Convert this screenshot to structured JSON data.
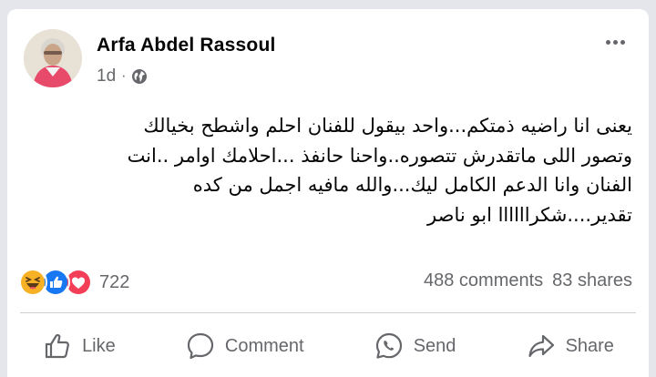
{
  "post": {
    "author": "Arfa Abdel Rassoul",
    "time": "1d",
    "separator": "·",
    "privacy_icon": "globe-icon",
    "lines": [
      "يعنى انا راضيه ذمتكم...واحد بيقول للفنان احلم واشطح بخيالك",
      "وتصور اللى ماتقدرش تتصوره..واحنا حانفذ ...احلامك اوامر ..انت",
      "الفنان وانا الدعم الكامل ليك...والله مافيه اجمل من كده",
      "تقدير....شكراااااا ابو ناصر"
    ]
  },
  "reactions": {
    "icons": [
      "haha-icon",
      "like-icon",
      "love-icon"
    ],
    "count": "722",
    "comments": "488 comments",
    "shares": "83 shares"
  },
  "actions": {
    "like": "Like",
    "comment": "Comment",
    "send": "Send",
    "share": "Share"
  },
  "colors": {
    "like_blue": "#1877f2",
    "love_red": "#f33e58",
    "haha_yellow": "#f7b125",
    "secondary_text": "#65676b"
  }
}
